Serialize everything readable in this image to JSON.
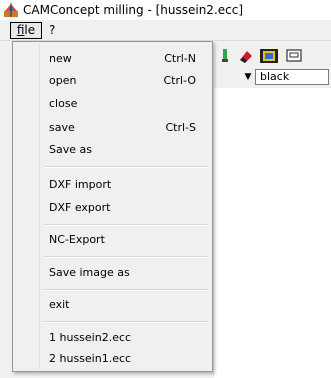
{
  "window": {
    "title": "CAMConcept milling - [hussein2.ecc]"
  },
  "menubar": {
    "file": "file",
    "file_hotkey": "f",
    "file_rest": "ile",
    "help": "?"
  },
  "toolbar": {
    "color_value": "black",
    "icons": [
      "tool-icon",
      "eraser-icon",
      "film-icon",
      "display-icon"
    ]
  },
  "file_menu": {
    "items": [
      {
        "label": "new",
        "shortcut": "Ctrl-N"
      },
      {
        "label": "open",
        "shortcut": "Ctrl-O"
      },
      {
        "label": "close",
        "shortcut": ""
      },
      {
        "label": "save",
        "shortcut": "Ctrl-S"
      },
      {
        "label": "Save as",
        "shortcut": ""
      },
      {
        "label": "DXF import",
        "shortcut": ""
      },
      {
        "label": "DXF export",
        "shortcut": ""
      },
      {
        "label": "NC-Export",
        "shortcut": ""
      },
      {
        "label": "Save image as",
        "shortcut": ""
      },
      {
        "label": "exit",
        "shortcut": ""
      },
      {
        "label": "1 hussein2.ecc",
        "shortcut": ""
      },
      {
        "label": "2 hussein1.ecc",
        "shortcut": ""
      }
    ]
  }
}
